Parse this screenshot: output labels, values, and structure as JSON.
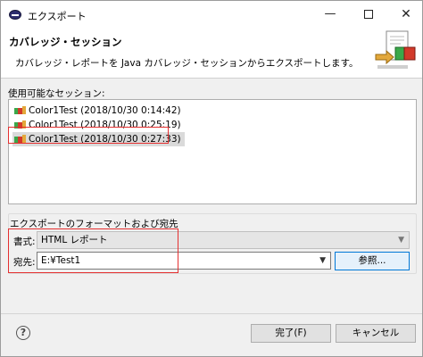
{
  "window": {
    "title": "エクスポート"
  },
  "banner": {
    "title": "カバレッジ・セッション",
    "description": "カバレッジ・レポートを Java カバレッジ・セッションからエクスポートします。"
  },
  "sessions": {
    "label": "使用可能なセッション:",
    "items": [
      {
        "label": "Color1Test (2018/10/30 0:14:42)"
      },
      {
        "label": "Color1Test (2018/10/30 0:25:19)"
      },
      {
        "label": "Color1Test (2018/10/30 0:27:33)"
      }
    ]
  },
  "export_format": {
    "group_title": "エクスポートのフォーマットおよび宛先",
    "format_label": "書式:",
    "format_value": "HTML レポート",
    "dest_label": "宛先:",
    "dest_value": "E:¥Test1",
    "browse_label": "参照..."
  },
  "footer": {
    "finish_label": "完了(F)",
    "cancel_label": "キャンセル"
  },
  "colors": {
    "highlight": "#e53030",
    "accent": "#0078d7"
  }
}
